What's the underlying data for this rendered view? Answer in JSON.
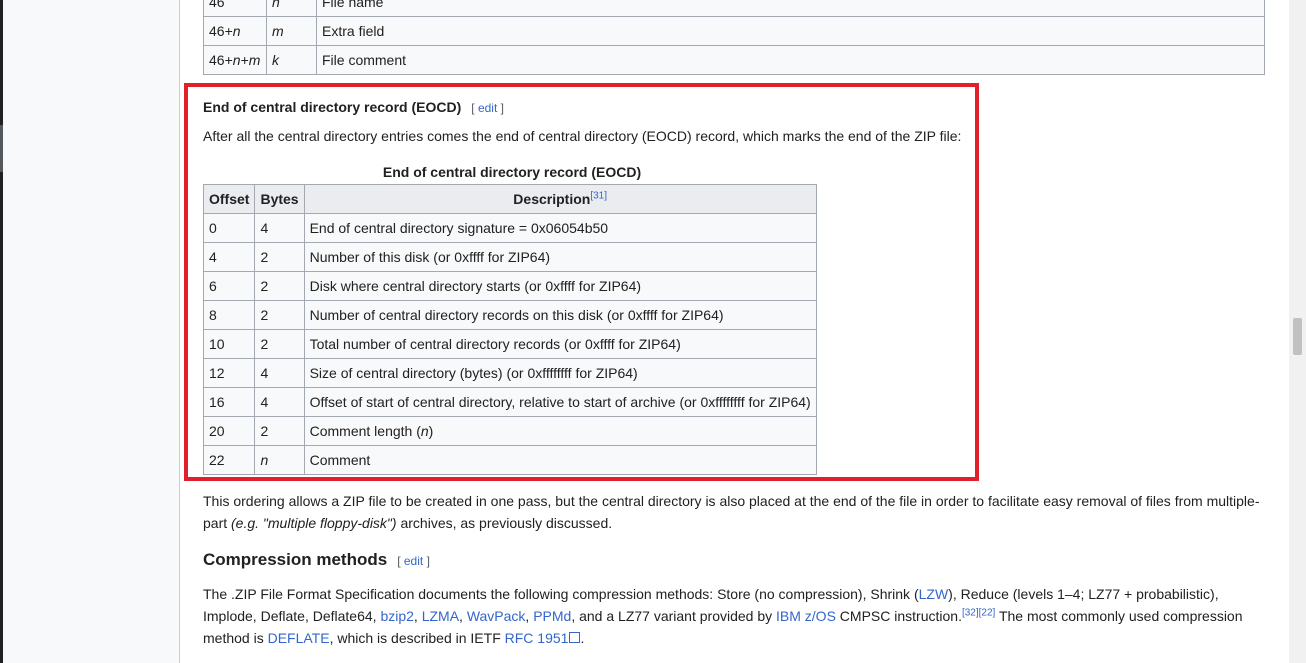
{
  "top_table": {
    "rows": [
      {
        "offset": "46",
        "bytes": "n",
        "description": "File name"
      },
      {
        "offset": "46+n",
        "bytes": "m",
        "description": "Extra field"
      },
      {
        "offset": "46+n+m",
        "bytes": "k",
        "description": "File comment"
      }
    ]
  },
  "eocd_section": {
    "heading": "End of central directory record (EOCD)",
    "edit_label": "edit",
    "intro": "After all the central directory entries comes the end of central directory (EOCD) record, which marks the end of the ZIP file:",
    "caption": "End of central directory record (EOCD)",
    "headers": {
      "offset": "Offset",
      "bytes": "Bytes",
      "description": "Description",
      "ref": "[31]"
    },
    "rows": [
      {
        "offset": "0",
        "bytes": "4",
        "description": "End of central directory signature = 0x06054b50"
      },
      {
        "offset": "4",
        "bytes": "2",
        "description": "Number of this disk (or 0xffff for ZIP64)"
      },
      {
        "offset": "6",
        "bytes": "2",
        "description": "Disk where central directory starts (or 0xffff for ZIP64)"
      },
      {
        "offset": "8",
        "bytes": "2",
        "description": "Number of central directory records on this disk (or 0xffff for ZIP64)"
      },
      {
        "offset": "10",
        "bytes": "2",
        "description": "Total number of central directory records (or 0xffff for ZIP64)"
      },
      {
        "offset": "12",
        "bytes": "4",
        "description": "Size of central directory (bytes) (or 0xffffffff for ZIP64)"
      },
      {
        "offset": "16",
        "bytes": "4",
        "description": "Offset of start of central directory, relative to start of archive (or 0xffffffff for ZIP64)"
      },
      {
        "offset": "20",
        "bytes": "2",
        "description": "Comment length (n)"
      },
      {
        "offset": "22",
        "bytes": "n",
        "description": "Comment"
      }
    ],
    "after_text_1": "This ordering allows a ZIP file to be created in one pass, but the central directory is also placed at the end of the file in order to facilitate easy removal of files from multiple-part ",
    "after_text_italic": "(e.g. \"multiple floppy-disk\")",
    "after_text_2": " archives, as previously discussed."
  },
  "compression_section": {
    "heading": "Compression methods",
    "edit_label": "edit",
    "t1": "The .ZIP File Format Specification documents the following compression methods: Store (no compression), Shrink (",
    "lzw": "LZW",
    "t2": "), Reduce (levels 1–4; LZ77 + probabilistic), Implode, Deflate, Deflate64, ",
    "bzip2": "bzip2",
    "lzma": "LZMA",
    "wavpack": "WavPack",
    "ppmd": "PPMd",
    "t3": ", and a LZ77 variant provided by ",
    "ibm": "IBM z/OS",
    "t4": " CMPSC instruction.",
    "refs": "[32][22]",
    "t5": " The most commonly used compression method is ",
    "deflate": "DEFLATE",
    "t6": ", which is described in IETF ",
    "rfc": "RFC 1951",
    "t7": "."
  },
  "colors": {
    "highlight": "#e0202a",
    "link": "#3366cc"
  }
}
